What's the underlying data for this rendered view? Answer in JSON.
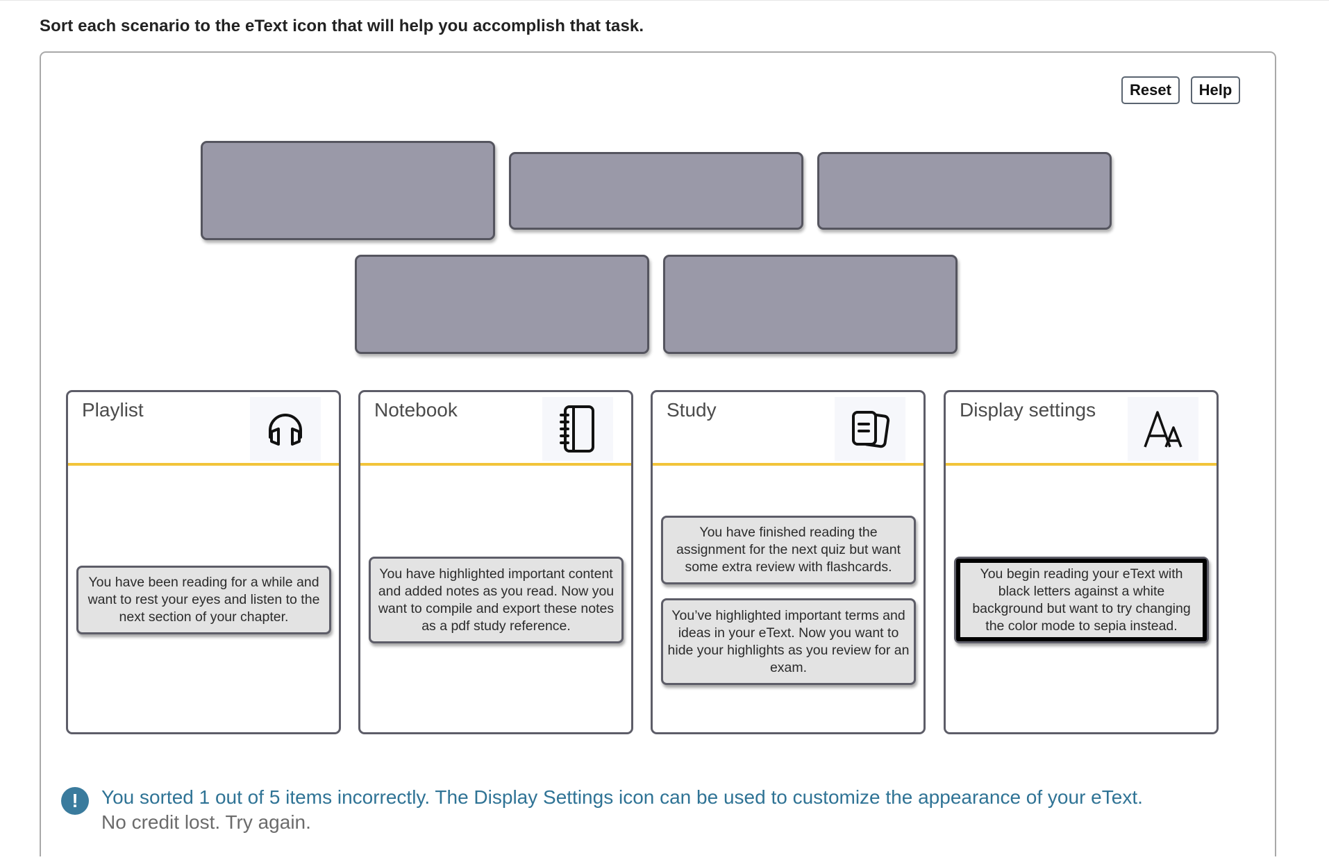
{
  "instructions": "Sort each scenario to the eText icon that will help you accomplish that task.",
  "toolbar": {
    "reset_label": "Reset",
    "help_label": "Help"
  },
  "drop_slots": [
    {
      "state": "empty"
    },
    {
      "state": "empty"
    },
    {
      "state": "empty"
    },
    {
      "state": "empty"
    },
    {
      "state": "empty"
    }
  ],
  "columns": [
    {
      "title": "Playlist",
      "icon": "headphones-icon",
      "cards": [
        {
          "text": "You have been reading for a while and want to rest your eyes and listen to the next section of your chapter."
        }
      ]
    },
    {
      "title": "Notebook",
      "icon": "notebook-icon",
      "cards": [
        {
          "text": "You have highlighted important content and added notes as you read. Now you want to compile and export these notes as a pdf study reference."
        }
      ]
    },
    {
      "title": "Study",
      "icon": "flashcards-icon",
      "cards": [
        {
          "text": "You have finished reading the assignment for the next quiz but want some extra review with flashcards."
        },
        {
          "text": "You’ve highlighted important terms and ideas in your eText. Now you want to hide your highlights as you review for an exam."
        }
      ]
    },
    {
      "title": "Display settings",
      "icon": "font-size-icon",
      "cards": [
        {
          "text": "You begin reading your eText with black letters against a white background but want to try changing the color mode to sepia instead.",
          "selected": true
        }
      ]
    }
  ],
  "feedback": {
    "icon": "exclamation-icon",
    "icon_glyph": "!",
    "message": "You sorted 1 out of 5 items incorrectly. The Display Settings icon can be used to customize the appearance of your eText.",
    "submessage": "No credit lost. Try again.",
    "message_color": "#2f7395",
    "icon_color": "#3a7b9d"
  },
  "colors": {
    "column_header_accent": "#f2c43a",
    "slot_fill": "#9a99a8",
    "card_fill": "#e3e3e3"
  }
}
